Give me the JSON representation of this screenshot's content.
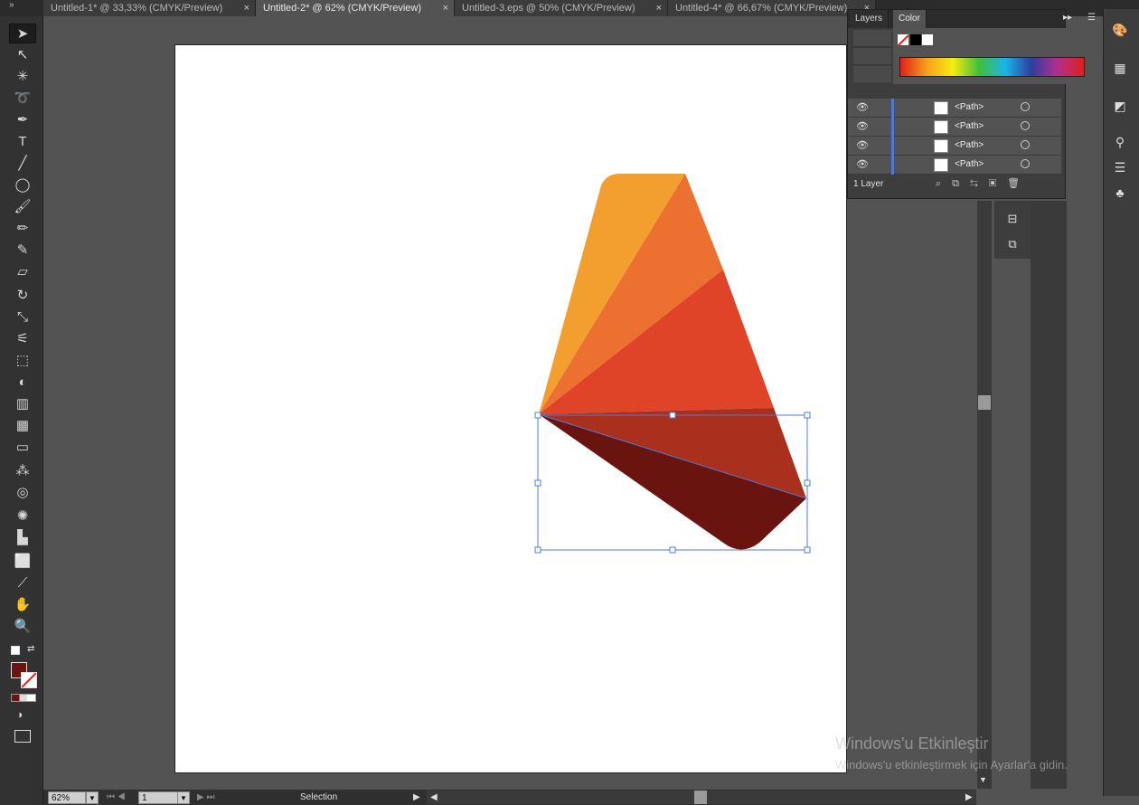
{
  "tabs": [
    {
      "label": "Untitled-1* @ 33,33% (CMYK/Preview)",
      "close": "×"
    },
    {
      "label": "Untitled-2* @ 62% (CMYK/Preview)",
      "close": "×"
    },
    {
      "label": "Untitled-3.eps @ 50% (CMYK/Preview)",
      "close": "×"
    },
    {
      "label": "Untitled-4* @ 66,67% (CMYK/Preview)",
      "close": "×"
    }
  ],
  "collapse_glyph": "»",
  "panels": {
    "layers_tab": "Layers",
    "color_tab": "Color",
    "layer_count": "1 Layer",
    "layer_rows": [
      {
        "name": "<Path>"
      },
      {
        "name": "<Path>"
      },
      {
        "name": "<Path>"
      },
      {
        "name": "<Path>"
      }
    ],
    "eye_glyph": "👁"
  },
  "tools": [
    {
      "icon": "selection-tool-icon",
      "glyph": "➤"
    },
    {
      "icon": "direct-selection-tool-icon",
      "glyph": "↖"
    },
    {
      "icon": "magic-wand-tool-icon",
      "glyph": "✳"
    },
    {
      "icon": "lasso-tool-icon",
      "glyph": "➰"
    },
    {
      "icon": "pen-tool-icon",
      "glyph": "✒"
    },
    {
      "icon": "type-tool-icon",
      "glyph": "T"
    },
    {
      "icon": "line-tool-icon",
      "glyph": "╱"
    },
    {
      "icon": "ellipse-tool-icon",
      "glyph": "◯"
    },
    {
      "icon": "paintbrush-tool-icon",
      "glyph": "🖌"
    },
    {
      "icon": "pencil-tool-icon",
      "glyph": "✏"
    },
    {
      "icon": "blob-brush-tool-icon",
      "glyph": "✎"
    },
    {
      "icon": "eraser-tool-icon",
      "glyph": "▱"
    },
    {
      "icon": "rotate-tool-icon",
      "glyph": "↻"
    },
    {
      "icon": "scale-tool-icon",
      "glyph": "⤡"
    },
    {
      "icon": "width-tool-icon",
      "glyph": "⚟"
    },
    {
      "icon": "free-transform-tool-icon",
      "glyph": "⬚"
    },
    {
      "icon": "shape-builder-tool-icon",
      "glyph": "◐"
    },
    {
      "icon": "perspective-grid-tool-icon",
      "glyph": "▥"
    },
    {
      "icon": "mesh-tool-icon",
      "glyph": "▦"
    },
    {
      "icon": "gradient-tool-icon",
      "glyph": "▭"
    },
    {
      "icon": "eyedropper-tool-icon",
      "glyph": "⁂"
    },
    {
      "icon": "blend-tool-icon",
      "glyph": "◎"
    },
    {
      "icon": "symbol-sprayer-tool-icon",
      "glyph": "✺"
    },
    {
      "icon": "column-graph-tool-icon",
      "glyph": "▙"
    },
    {
      "icon": "artboard-tool-icon",
      "glyph": "⬜"
    },
    {
      "icon": "slice-tool-icon",
      "glyph": "⟋"
    },
    {
      "icon": "hand-tool-icon",
      "glyph": "✋"
    },
    {
      "icon": "zoom-tool-icon",
      "glyph": "🔍"
    }
  ],
  "status": {
    "zoom": "62%",
    "artboard_number": "1",
    "tool_name": "Selection"
  },
  "watermark": {
    "line1": "Windows'u Etkinleştir",
    "line2": "Windows'u etkinleştirmek için Ayarlar'a gidin."
  },
  "colors": {
    "fill_color": "#6b1410",
    "art_orange_light": "#f39f2f",
    "art_orange": "#ec7030",
    "art_red": "#e04428",
    "art_dark_red": "#a8301c",
    "art_maroon": "#6a1410",
    "selection": "#4a7de0"
  }
}
